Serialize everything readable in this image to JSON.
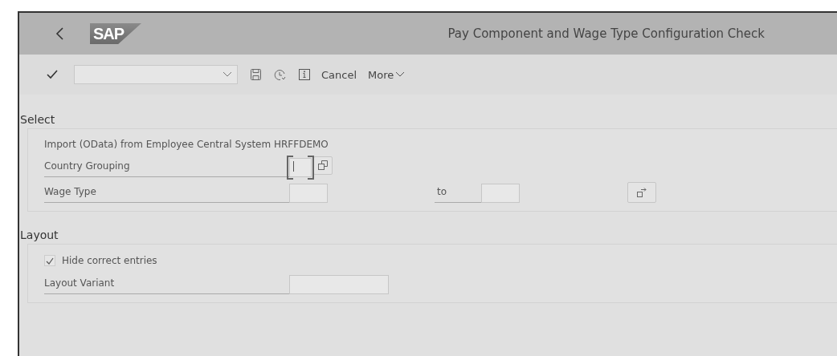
{
  "header": {
    "logo": "SAP",
    "title": "Pay Component and Wage Type Configuration Check"
  },
  "toolbar": {
    "cancel": "Cancel",
    "more": "More"
  },
  "select": {
    "title": "Select",
    "info": "Import (OData) from Employee Central System HRFFDEMO",
    "fields": [
      {
        "label": "Country Grouping",
        "kind": "single",
        "focused": true
      },
      {
        "label": "Wage Type",
        "kind": "range",
        "focused": false,
        "to_label": "to"
      }
    ]
  },
  "layout": {
    "title": "Layout",
    "checkbox": {
      "label": "Hide correct entries",
      "checked": true
    },
    "fields": [
      {
        "label": "Layout Variant",
        "kind": "wide",
        "focused": false
      }
    ]
  }
}
